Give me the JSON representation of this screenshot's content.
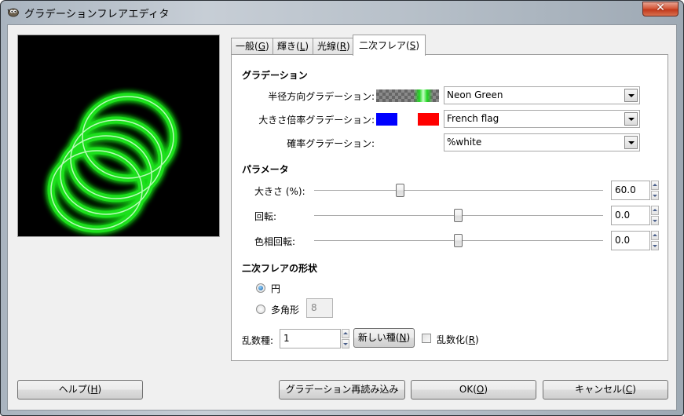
{
  "window": {
    "title": "グラデーションフレアエディタ",
    "app_icon": "gimp-wilber-icon",
    "close_label": "✕"
  },
  "tabs": [
    {
      "label": "一般",
      "mnemonic": "G",
      "active": false
    },
    {
      "label": "輝き",
      "mnemonic": "L",
      "active": false
    },
    {
      "label": "光線",
      "mnemonic": "R",
      "active": false
    },
    {
      "label": "二次フレア",
      "mnemonic": "S",
      "active": true
    }
  ],
  "gradients": {
    "section_title": "グラデーション",
    "radial": {
      "label": "半径方向グラデーション:",
      "value": "Neon Green"
    },
    "size_factor": {
      "label": "大きさ倍率グラデーション:",
      "value": "French flag",
      "swatch_left": "#0000ff",
      "swatch_right": "#ff0000"
    },
    "probability": {
      "label": "確率グラデーション:",
      "value": "%white"
    }
  },
  "parameters": {
    "section_title": "パラメータ",
    "size": {
      "label": "大きさ (%):",
      "value": "60.0",
      "slider_fraction": 0.3
    },
    "rotation": {
      "label": "回転:",
      "value": "0.0",
      "slider_fraction": 0.5
    },
    "hue_rotation": {
      "label": "色相回転:",
      "value": "0.0",
      "slider_fraction": 0.5
    }
  },
  "shape": {
    "section_title": "二次フレアの形状",
    "circle_label": "円",
    "polygon_label": "多角形",
    "polygon_sides": "8",
    "selected": "circle"
  },
  "random": {
    "seed_label": "乱数種:",
    "seed_value": "1",
    "new_seed_label": "新しい種(",
    "new_seed_mnemonic": "N",
    "randomize_label": "乱数化(",
    "randomize_mnemonic": "R",
    "randomize_checked": false
  },
  "buttons": {
    "help": {
      "label": "ヘルプ(",
      "mnemonic": "H"
    },
    "reload": {
      "label": "グラデーション再読み込み"
    },
    "ok": {
      "label": "OK(",
      "mnemonic": "O"
    },
    "cancel": {
      "label": "キャンセル(",
      "mnemonic": "C"
    }
  },
  "colors": {
    "flare_green": "#22ff22",
    "preview_bg": "#000000"
  }
}
